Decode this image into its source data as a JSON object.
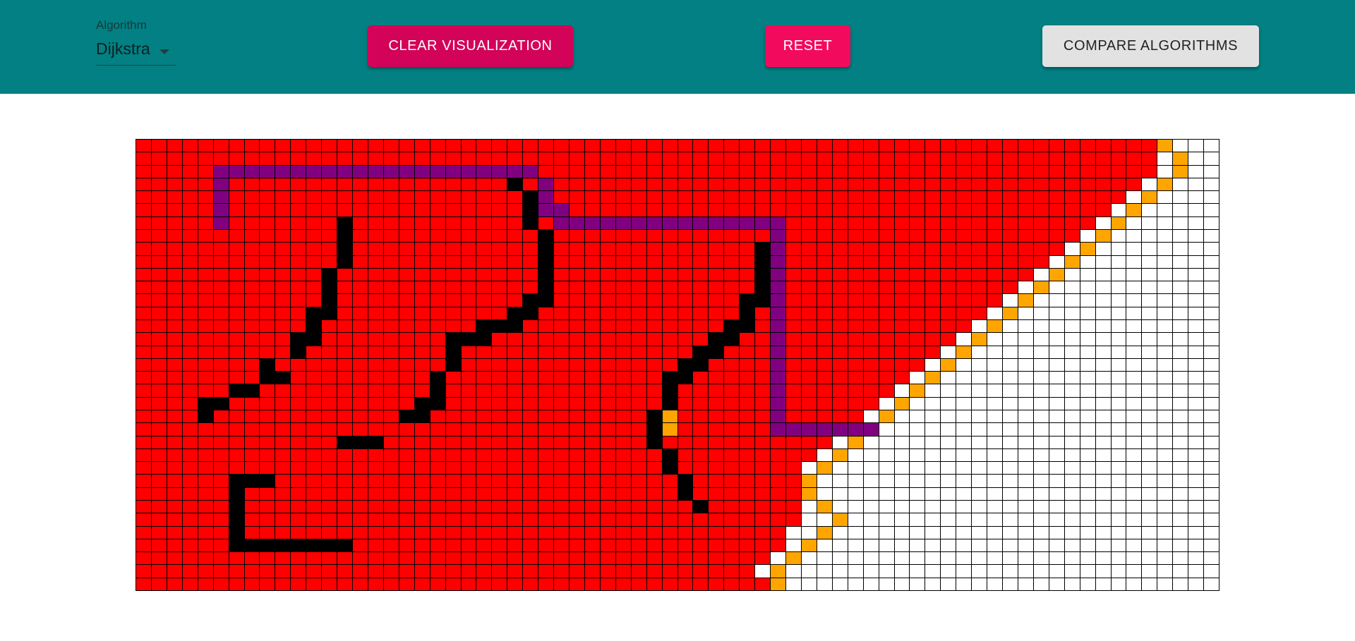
{
  "toolbar": {
    "algorithm_label": "Algorithm",
    "algorithm_value": "Dijkstra",
    "clear_label": "CLEAR VISUALIZATION",
    "reset_label": "RESET",
    "compare_label": "COMPARE ALGORITHMS"
  },
  "colors": {
    "app_bar": "#028083",
    "visited": "#ff0000",
    "wall": "#000000",
    "path": "#800080",
    "frontier": "#ffa500",
    "unvisited": "#ffffff",
    "clear_button": "#d20358",
    "reset_button": "#f20b5c",
    "compare_button": "#e2e2e2"
  },
  "grid": {
    "rows": 35,
    "cols": 70,
    "visited_columns_by_row": [
      66,
      66,
      66,
      65,
      64,
      63,
      62,
      61,
      60,
      59,
      58,
      57,
      56,
      55,
      54,
      53,
      52,
      51,
      50,
      49,
      48,
      47,
      46,
      45,
      44,
      43,
      43,
      43,
      43,
      43,
      42,
      42,
      41,
      40,
      41
    ],
    "frontier_cells": [
      [
        0,
        66
      ],
      [
        1,
        67
      ],
      [
        2,
        67
      ],
      [
        3,
        66
      ],
      [
        4,
        65
      ],
      [
        5,
        64
      ],
      [
        6,
        63
      ],
      [
        7,
        62
      ],
      [
        8,
        61
      ],
      [
        9,
        60
      ],
      [
        10,
        59
      ],
      [
        11,
        58
      ],
      [
        12,
        57
      ],
      [
        13,
        56
      ],
      [
        14,
        55
      ],
      [
        15,
        54
      ],
      [
        16,
        53
      ],
      [
        17,
        52
      ],
      [
        18,
        51
      ],
      [
        19,
        50
      ],
      [
        20,
        49
      ],
      [
        21,
        48
      ],
      [
        22,
        47
      ],
      [
        23,
        46
      ],
      [
        24,
        45
      ],
      [
        25,
        44
      ],
      [
        26,
        43
      ],
      [
        27,
        43
      ],
      [
        28,
        44
      ],
      [
        29,
        45
      ],
      [
        30,
        44
      ],
      [
        31,
        43
      ],
      [
        32,
        42
      ],
      [
        33,
        41
      ],
      [
        34,
        41
      ],
      [
        21,
        34
      ],
      [
        22,
        34
      ]
    ],
    "wall_cells": [
      [
        3,
        24
      ],
      [
        4,
        25
      ],
      [
        5,
        25
      ],
      [
        6,
        25
      ],
      [
        7,
        26
      ],
      [
        8,
        26
      ],
      [
        9,
        26
      ],
      [
        10,
        26
      ],
      [
        11,
        26
      ],
      [
        12,
        25
      ],
      [
        12,
        26
      ],
      [
        13,
        24
      ],
      [
        13,
        25
      ],
      [
        14,
        22
      ],
      [
        14,
        23
      ],
      [
        14,
        24
      ],
      [
        15,
        20
      ],
      [
        15,
        21
      ],
      [
        15,
        22
      ],
      [
        16,
        20
      ],
      [
        17,
        20
      ],
      [
        18,
        19
      ],
      [
        19,
        19
      ],
      [
        20,
        18
      ],
      [
        20,
        19
      ],
      [
        21,
        17
      ],
      [
        21,
        18
      ],
      [
        6,
        13
      ],
      [
        7,
        13
      ],
      [
        8,
        13
      ],
      [
        9,
        13
      ],
      [
        10,
        12
      ],
      [
        11,
        12
      ],
      [
        12,
        12
      ],
      [
        13,
        11
      ],
      [
        13,
        12
      ],
      [
        14,
        11
      ],
      [
        15,
        10
      ],
      [
        15,
        11
      ],
      [
        16,
        10
      ],
      [
        17,
        8
      ],
      [
        18,
        8
      ],
      [
        18,
        9
      ],
      [
        19,
        6
      ],
      [
        19,
        7
      ],
      [
        20,
        4
      ],
      [
        20,
        5
      ],
      [
        21,
        4
      ],
      [
        23,
        13
      ],
      [
        23,
        14
      ],
      [
        23,
        15
      ],
      [
        8,
        40
      ],
      [
        9,
        40
      ],
      [
        10,
        40
      ],
      [
        11,
        40
      ],
      [
        12,
        39
      ],
      [
        12,
        40
      ],
      [
        13,
        39
      ],
      [
        14,
        38
      ],
      [
        14,
        39
      ],
      [
        15,
        37
      ],
      [
        15,
        38
      ],
      [
        16,
        36
      ],
      [
        16,
        37
      ],
      [
        17,
        35
      ],
      [
        17,
        36
      ],
      [
        18,
        34
      ],
      [
        18,
        35
      ],
      [
        19,
        34
      ],
      [
        20,
        34
      ],
      [
        21,
        33
      ],
      [
        22,
        33
      ],
      [
        23,
        33
      ],
      [
        24,
        34
      ],
      [
        25,
        34
      ],
      [
        26,
        35
      ],
      [
        27,
        35
      ],
      [
        28,
        36
      ],
      [
        26,
        6
      ],
      [
        26,
        7
      ],
      [
        26,
        8
      ],
      [
        27,
        6
      ],
      [
        28,
        6
      ],
      [
        29,
        6
      ],
      [
        30,
        6
      ],
      [
        31,
        6
      ],
      [
        31,
        7
      ],
      [
        31,
        8
      ],
      [
        31,
        9
      ],
      [
        31,
        10
      ],
      [
        31,
        11
      ],
      [
        31,
        12
      ],
      [
        31,
        13
      ]
    ],
    "path_segments": [
      {
        "row": 2,
        "from": 5,
        "to": 25
      },
      {
        "row": 3,
        "from": 26,
        "to": 26
      },
      {
        "row": 4,
        "from": 26,
        "to": 26
      },
      {
        "row": 5,
        "from": 26,
        "to": 27
      },
      {
        "row": 6,
        "from": 27,
        "to": 41
      },
      {
        "row": 22,
        "from": 41,
        "to": 47
      },
      {
        "col": 5,
        "from": 2,
        "to": 6
      },
      {
        "col": 41,
        "from": 6,
        "to": 22
      }
    ]
  }
}
